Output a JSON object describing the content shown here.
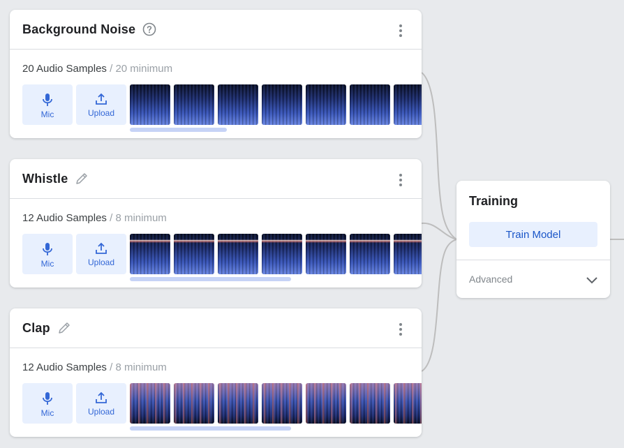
{
  "classes": [
    {
      "title": "Background Noise",
      "title_icon": "help-circle-icon",
      "count_label": "20 Audio Samples",
      "separator": "/",
      "minimum_label": "20 minimum",
      "mic_label": "Mic",
      "upload_label": "Upload",
      "thumbnail_style": "noise",
      "scroll_fraction": 0.33
    },
    {
      "title": "Whistle",
      "title_icon": "pencil-icon",
      "count_label": "12 Audio Samples",
      "separator": "/",
      "minimum_label": "8 minimum",
      "mic_label": "Mic",
      "upload_label": "Upload",
      "thumbnail_style": "whistle",
      "scroll_fraction": 0.55
    },
    {
      "title": "Clap",
      "title_icon": "pencil-icon",
      "count_label": "12 Audio Samples",
      "separator": "/",
      "minimum_label": "8 minimum",
      "mic_label": "Mic",
      "upload_label": "Upload",
      "thumbnail_style": "clap",
      "scroll_fraction": 0.55
    }
  ],
  "training": {
    "title": "Training",
    "button_label": "Train Model",
    "advanced_label": "Advanced",
    "advanced_icon": "chevron-down-icon"
  },
  "colors": {
    "background": "#e8eaed",
    "accent": "#1a73e8",
    "button_fill": "#e8f0fe",
    "scrollbar": "#c6d3f6",
    "connector": "#bdbdbd"
  }
}
